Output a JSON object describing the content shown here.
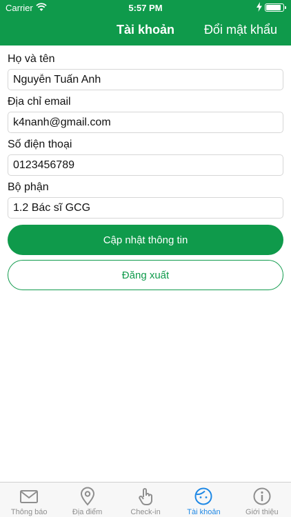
{
  "status_bar": {
    "carrier": "Carrier",
    "time": "5:57 PM"
  },
  "nav": {
    "title": "Tài khoản",
    "right_action": "Đổi mật khẩu"
  },
  "form": {
    "name_label": "Họ và tên",
    "name_value": "Nguyễn Tuấn Anh",
    "email_label": "Địa chỉ email",
    "email_value": "k4nanh@gmail.com",
    "phone_label": "Số điện thoại",
    "phone_value": "0123456789",
    "department_label": "Bộ phận",
    "department_value": "1.2 Bác sĩ GCG"
  },
  "buttons": {
    "update": "Cập nhật thông tin",
    "logout": "Đăng xuất"
  },
  "tabs": [
    {
      "label": "Thông báo",
      "icon": "mail-icon"
    },
    {
      "label": "Địa điểm",
      "icon": "location-pin-icon"
    },
    {
      "label": "Check-in",
      "icon": "hand-tap-icon"
    },
    {
      "label": "Tài khoản",
      "icon": "account-face-icon",
      "active": true
    },
    {
      "label": "Giới thiệu",
      "icon": "info-icon"
    }
  ],
  "colors": {
    "primary": "#0f9a4b",
    "tab_active": "#1e88e5",
    "tab_inactive": "#8e8e8e"
  }
}
